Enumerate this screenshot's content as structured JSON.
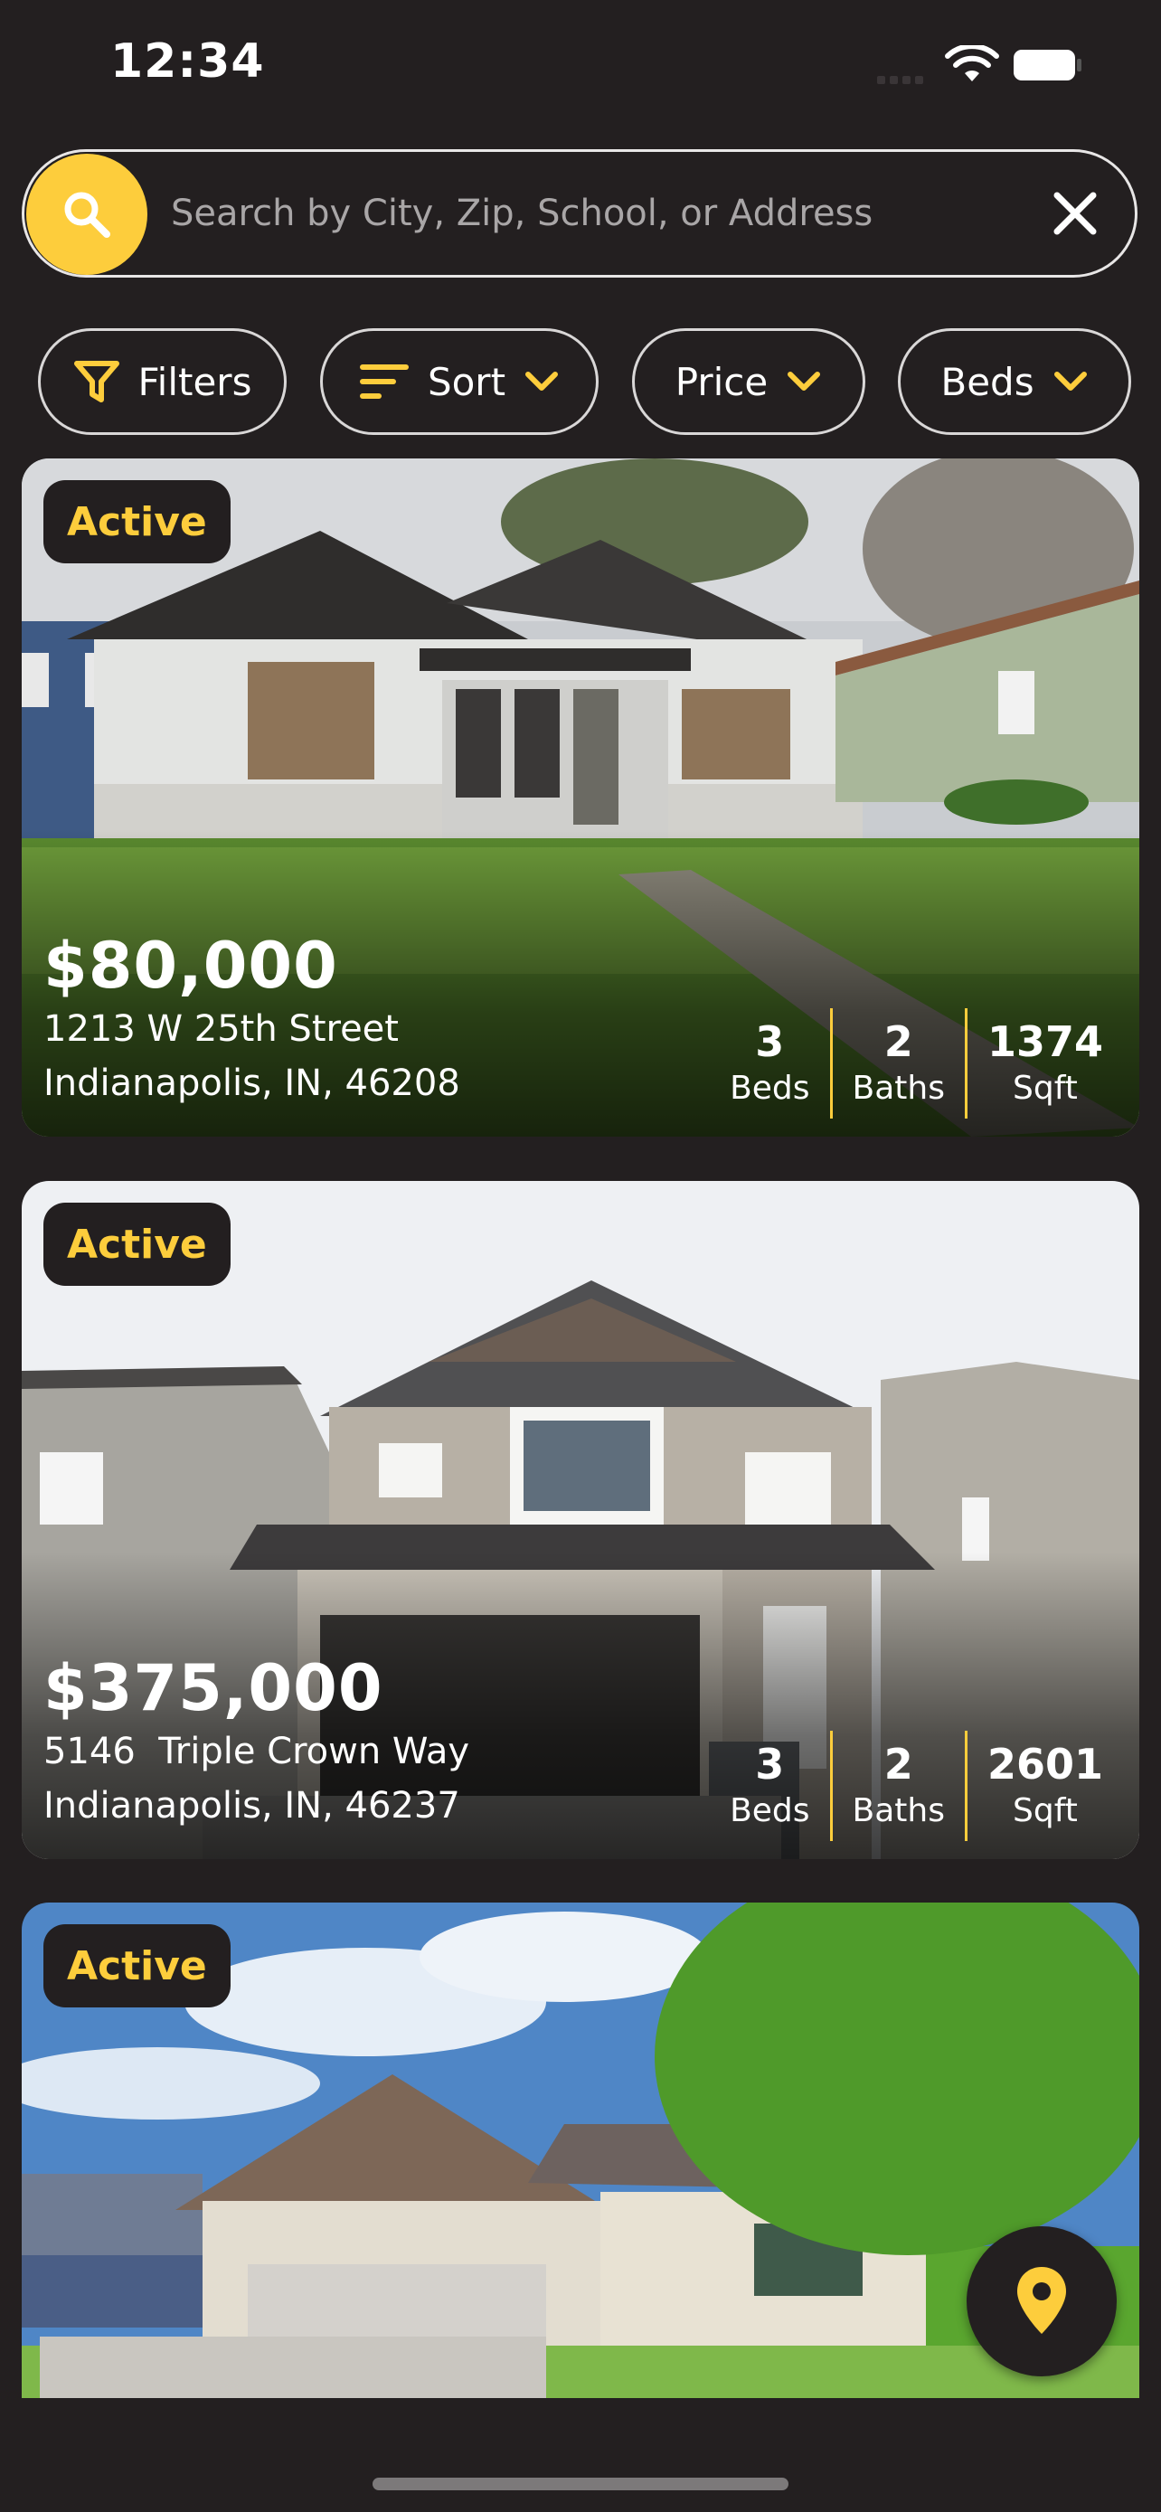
{
  "status_bar": {
    "time": "12:34"
  },
  "search": {
    "placeholder": "Search by City, Zip, School, or Address"
  },
  "filter_chips": [
    {
      "label": "Filters"
    },
    {
      "label": "Sort"
    },
    {
      "label": "Price"
    },
    {
      "label": "Beds"
    }
  ],
  "listings": [
    {
      "status": "Active",
      "price": "$80,000",
      "address_line1": "1213 W 25th Street",
      "address_line2": "Indianapolis, IN, 46208",
      "beds": "3",
      "baths": "2",
      "sqft": "1374",
      "beds_label": "Beds",
      "baths_label": "Baths",
      "sqft_label": "Sqft"
    },
    {
      "status": "Active",
      "price": "$375,000",
      "address_line1": "5146  Triple Crown Way",
      "address_line2": "Indianapolis, IN, 46237",
      "beds": "3",
      "baths": "2",
      "sqft": "2601",
      "beds_label": "Beds",
      "baths_label": "Baths",
      "sqft_label": "Sqft"
    },
    {
      "status": "Active"
    }
  ],
  "colors": {
    "accent": "#fdcd3c",
    "background": "#231f20"
  },
  "icons": {
    "search": "search-icon",
    "close": "close-icon",
    "map": "map-pin-icon"
  }
}
